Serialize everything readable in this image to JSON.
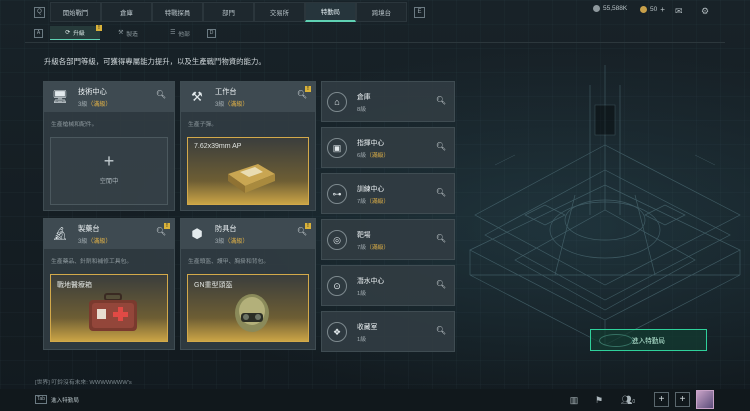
{
  "topbar": {
    "left_key": "Q",
    "right_key": "E",
    "tabs": [
      "開始戰鬥",
      "倉庫",
      "特戰探員",
      "部門",
      "交易所",
      "特勤局",
      "跨境台"
    ],
    "active_tab": 5,
    "currency_label": "55,588K",
    "coins_label": "50",
    "mail_icon": "mail-icon",
    "settings_icon": "gear-icon"
  },
  "subbar": {
    "left_key": "A",
    "right_key": "D",
    "tabs": [
      {
        "label": "升級",
        "icon": "upgrade-icon",
        "badge": "!"
      },
      {
        "label": "製造",
        "icon": "craft-icon"
      },
      {
        "label": "他部",
        "icon": "list-icon"
      }
    ],
    "active_tab": 0
  },
  "description": "升級各部門等級，可獲得專屬能力提升，以及生產戰鬥物資的能力。",
  "cards": [
    {
      "name": "技術中心",
      "level": "3級",
      "max": "（滿級）",
      "sub": "生產槍械和配件。",
      "icon": "monitor-icon",
      "slot_type": "empty",
      "slot_plus": "+",
      "slot_label": "空閒中"
    },
    {
      "name": "工作台",
      "level": "3級",
      "max": "（滿級）",
      "sub": "生產子彈。",
      "icon": "tools-icon",
      "slot_type": "prod",
      "slot_label": "7.62x39mm AP",
      "badge": "!"
    },
    {
      "name": "製藥台",
      "level": "3級",
      "max": "（滿級）",
      "sub": "生產藥品、針劑和補修工具包。",
      "icon": "microscope-icon",
      "slot_type": "prod",
      "slot_label": "戰地醫療箱",
      "badge": "!"
    },
    {
      "name": "防具台",
      "level": "3級",
      "max": "（滿級）",
      "sub": "生產頭盔、護甲、胸掛和背包。",
      "icon": "armor-icon",
      "slot_type": "prod",
      "slot_label": "GN重型頭盔",
      "badge": "!"
    }
  ],
  "rows": [
    {
      "name": "倉庫",
      "level": "8級",
      "max": "",
      "icon": "warehouse-icon"
    },
    {
      "name": "指揮中心",
      "level": "6級",
      "max": "（滿級）",
      "icon": "chip-icon"
    },
    {
      "name": "訓練中心",
      "level": "7級",
      "max": "（滿級）",
      "icon": "dumbbell-icon"
    },
    {
      "name": "靶場",
      "level": "7級",
      "max": "（滿級）",
      "icon": "target-icon"
    },
    {
      "name": "潛水中心",
      "level": "1級",
      "max": "",
      "icon": "goggles-icon"
    },
    {
      "name": "收藏室",
      "level": "1級",
      "max": "",
      "icon": "collection-icon"
    }
  ],
  "enter_button": "進入特勤局",
  "chat": "[世界] 叮鈴沒有未來: WWWWWWW's",
  "bottombar": {
    "key": "Tab",
    "label": "進入特勤局",
    "icons": [
      "chart-icon",
      "broadcast-icon",
      "team-icon"
    ],
    "team_count": "0",
    "buttons": [
      "+",
      "+"
    ]
  },
  "colors": {
    "accent": "#5fd1b3",
    "max_level": "#e3b347",
    "enter_border": "#2fd19b"
  }
}
